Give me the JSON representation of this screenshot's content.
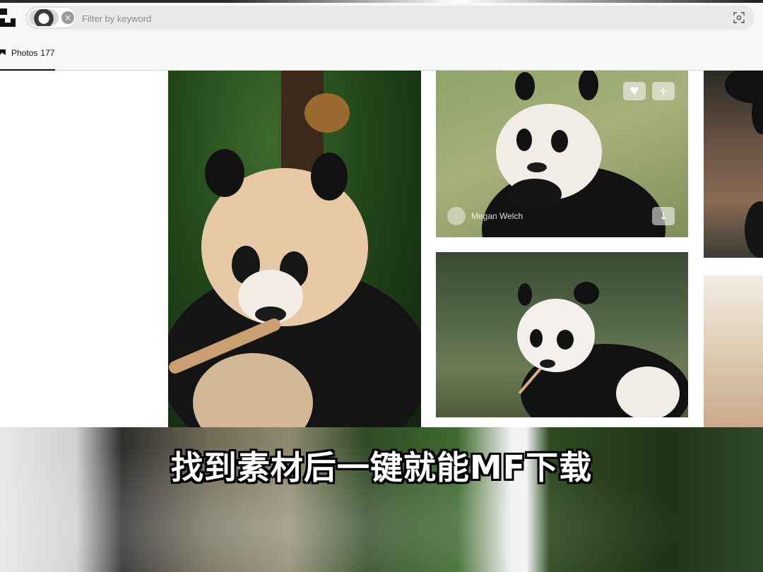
{
  "search": {
    "placeholder": "Filter by keyword",
    "chip_remove_symbol": "×"
  },
  "tabs": [
    {
      "label": "Photos",
      "count": "177"
    }
  ],
  "photo_card": {
    "author": "Megan Welch",
    "like_symbol": "♥",
    "add_symbol": "+",
    "download_symbol": "↓"
  },
  "caption": "找到素材后一键就能MF下载",
  "icons": {
    "logo": "logo-icon",
    "visual_search": "visual-search-icon",
    "photos_tab": "image-icon"
  }
}
